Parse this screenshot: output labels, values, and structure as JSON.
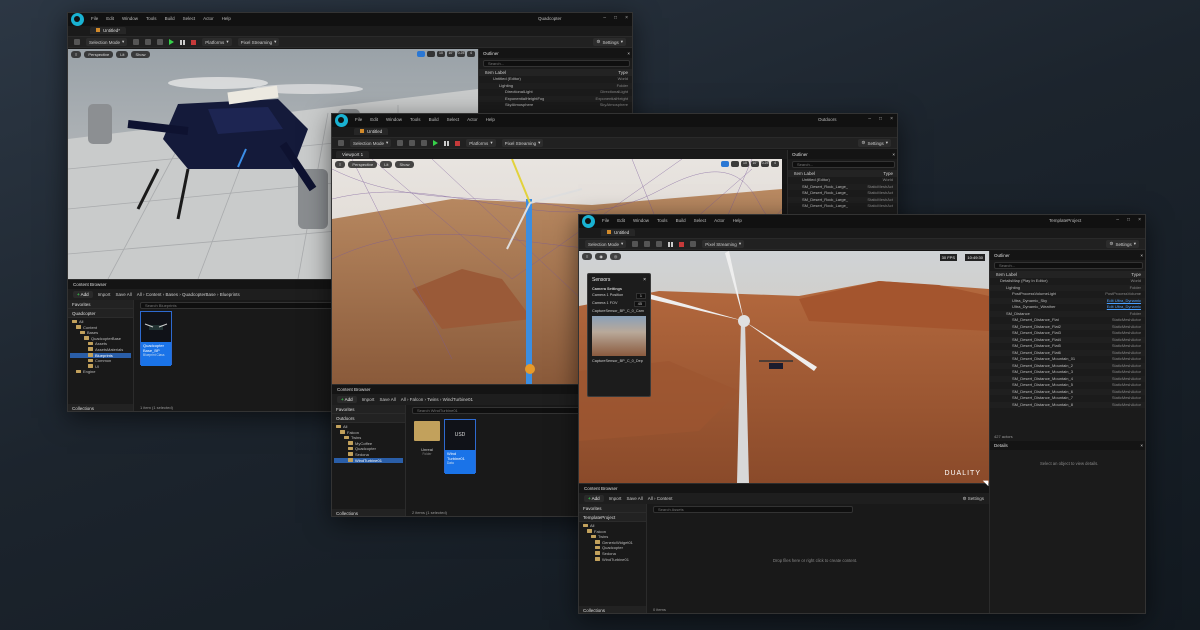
{
  "menu": [
    "File",
    "Edit",
    "Window",
    "Tools",
    "Build",
    "Select",
    "Actor",
    "Help"
  ],
  "toolbar": {
    "selection_mode": "Selection Mode",
    "platforms": "Platforms",
    "pixel_streaming": "Pixel Streaming",
    "settings": "Settings"
  },
  "viewport_bar": {
    "perspective": "Perspective",
    "lit": "Lit",
    "show": "Show"
  },
  "cb_common": {
    "add": "Add",
    "import": "Import",
    "save_all": "Save All",
    "favorites": "Favorites",
    "collections": "Collections",
    "settings": "Settings",
    "all": "All"
  },
  "outliner_common": {
    "title": "Outliner",
    "search": "Search...",
    "item_label": "Item Label",
    "type": "Type"
  },
  "win1": {
    "title": "Quadcopter",
    "tab": "Untitled*",
    "content_browser": "Content Browser",
    "breadcrumb": [
      "All",
      "Content",
      "Bases",
      "QuadcopterBase",
      "Blueprints"
    ],
    "search_placeholder": "Search Blueprints",
    "project": "Quadcopter",
    "tree": [
      "All",
      "Content",
      "Bases",
      "QuadcopterBase",
      "Assets",
      "AssetsMaterials",
      "Blueprints",
      "Common",
      "UI",
      "Engine"
    ],
    "asset_name": "Quadcopter Base_BP",
    "asset_type": "Blueprint Class",
    "status": "1 item (1 selected)",
    "outliner": [
      {
        "name": "Untitled (Editor)",
        "type": "World"
      },
      {
        "name": "Lighting",
        "type": "Folder"
      },
      {
        "name": "DirectionalLight",
        "type": "DirectionalLight"
      },
      {
        "name": "ExponentialHeightFog",
        "type": "ExponentialHeight"
      },
      {
        "name": "SkyAtmosphere",
        "type": "SkyAtmosphere"
      }
    ],
    "vp_icons": [
      "10",
      "10°",
      "0.25",
      "4"
    ]
  },
  "win2": {
    "title": "Outdoors",
    "tab": "Untitled",
    "viewport_tab": "Viewport 1",
    "content_browser": "Content Browser",
    "breadcrumb": [
      "All",
      "Falcon",
      "Twins",
      "WindTurbine01"
    ],
    "search_placeholder": "Search WindTurbine01",
    "project": "Outdoors",
    "tree": [
      "All",
      "Falcon",
      "Twins",
      "MyCoffee",
      "Quadcopter",
      "Sedona",
      "WindTurbine01"
    ],
    "asset1_thumb": "",
    "asset1_name": "Unreal",
    "asset1_type": "Folder",
    "asset2_thumb": "USD",
    "asset2_name": "Wind Turbine01",
    "asset2_type": "Data",
    "status": "2 items (1 selected)",
    "outliner": [
      {
        "name": "Untitled (Editor)",
        "type": "World"
      },
      {
        "name": "SM_Desert_Rock_Large_",
        "type": "StaticMeshAct"
      },
      {
        "name": "SM_Desert_Rock_Large_",
        "type": "StaticMeshAct"
      },
      {
        "name": "SM_Desert_Rock_Large_",
        "type": "StaticMeshAct"
      },
      {
        "name": "SM_Desert_Rock_Large_",
        "type": "StaticMeshAct"
      }
    ],
    "vp_icons": [
      "10",
      "10°",
      "0.25",
      "4"
    ]
  },
  "win3": {
    "title": "TemplateProject",
    "tab": "Untitled",
    "content_browser": "Content Browser",
    "breadcrumb": [
      "All",
      "Content"
    ],
    "search_placeholder": "Search Assets",
    "project": "TemplateProject",
    "tree": [
      "All",
      "Falcon",
      "Twins",
      "GenericWidget01",
      "Quadcopter",
      "Sedona",
      "WindTurbine01"
    ],
    "drop_hint": "Drop files here or right click to create content.",
    "status": "0 items",
    "fps": "30 FPS",
    "time": "10:49:30",
    "watermark": "DUALITY",
    "sensor": {
      "title": "Sensors",
      "section": "Camera Settings",
      "pos_label": "Camera 1 Position",
      "pos_value": "1",
      "fov_label": "Camera 1 FOV",
      "fov_value": "45",
      "sensor_name": "CaptureSensor_BP_C_0_Cam",
      "sensor_name2": "CaptureSensor_BP_C_0_Dep"
    },
    "outliner_count": "427 actors",
    "details_title": "Details",
    "details_hint": "Select an object to view details.",
    "outliner": [
      {
        "name": "DetailsMap (Play In Editor)",
        "type": "World",
        "link": false
      },
      {
        "name": "Lighting",
        "type": "Folder",
        "link": false
      },
      {
        "name": "PostProcessVolumeLight",
        "type": "PostProcessVolume",
        "link": false
      },
      {
        "name": "Ultra_Dynamic_Sky",
        "type": "Edit Ultra_Dynamic",
        "link": true
      },
      {
        "name": "Ultra_Dynamic_Weather",
        "type": "Edit Ultra_Dynamic",
        "link": true
      },
      {
        "name": "SM_Distance",
        "type": "Folder",
        "link": false
      },
      {
        "name": "SM_Desert_Distance_Flat",
        "type": "StaticMeshActor",
        "link": false
      },
      {
        "name": "SM_Desert_Distance_Flat2",
        "type": "StaticMeshActor",
        "link": false
      },
      {
        "name": "SM_Desert_Distance_Flat3",
        "type": "StaticMeshActor",
        "link": false
      },
      {
        "name": "SM_Desert_Distance_Flat4",
        "type": "StaticMeshActor",
        "link": false
      },
      {
        "name": "SM_Desert_Distance_Flat5",
        "type": "StaticMeshActor",
        "link": false
      },
      {
        "name": "SM_Desert_Distance_Flat6",
        "type": "StaticMeshActor",
        "link": false
      },
      {
        "name": "SM_Desert_Distance_Mountain_01",
        "type": "StaticMeshActor",
        "link": false
      },
      {
        "name": "SM_Desert_Distance_Mountain_2",
        "type": "StaticMeshActor",
        "link": false
      },
      {
        "name": "SM_Desert_Distance_Mountain_3",
        "type": "StaticMeshActor",
        "link": false
      },
      {
        "name": "SM_Desert_Distance_Mountain_4",
        "type": "StaticMeshActor",
        "link": false
      },
      {
        "name": "SM_Desert_Distance_Mountain_5",
        "type": "StaticMeshActor",
        "link": false
      },
      {
        "name": "SM_Desert_Distance_Mountain_6",
        "type": "StaticMeshActor",
        "link": false
      },
      {
        "name": "SM_Desert_Distance_Mountain_7",
        "type": "StaticMeshActor",
        "link": false
      },
      {
        "name": "SM_Desert_Distance_Mountain_8",
        "type": "StaticMeshActor",
        "link": false
      }
    ]
  }
}
